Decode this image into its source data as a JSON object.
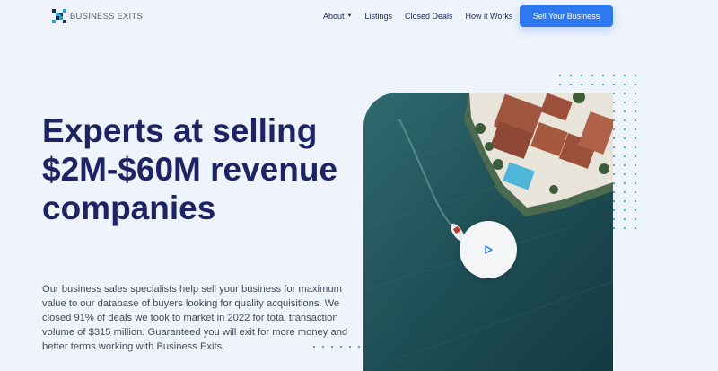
{
  "logo": {
    "text": "BUSINESS EXITS",
    "icon": "x-pixel-logo-icon",
    "color": "#1fa7c9"
  },
  "nav": {
    "items": [
      {
        "label": "About",
        "has_dropdown": true
      },
      {
        "label": "Listings"
      },
      {
        "label": "Closed Deals"
      },
      {
        "label": "How it Works"
      }
    ],
    "cta_label": "Sell Your Business"
  },
  "hero": {
    "headline": "Experts at selling $2M-$60M revenue companies",
    "body": "Our business sales specialists help sell your business for maximum value to our database of buyers looking for quality acquisitions. We closed 91% of deals we took to market in 2022 for total transaction volume of $315 million. Guaranteed you will exit for more money and better terms working with Business Exits.",
    "image": "aerial-waterfront-house-photo",
    "play_icon": "play-icon"
  },
  "colors": {
    "accent": "#2f79f0",
    "headline": "#1c2466",
    "background": "#eef3fc",
    "dots": "#1e8fb8"
  }
}
